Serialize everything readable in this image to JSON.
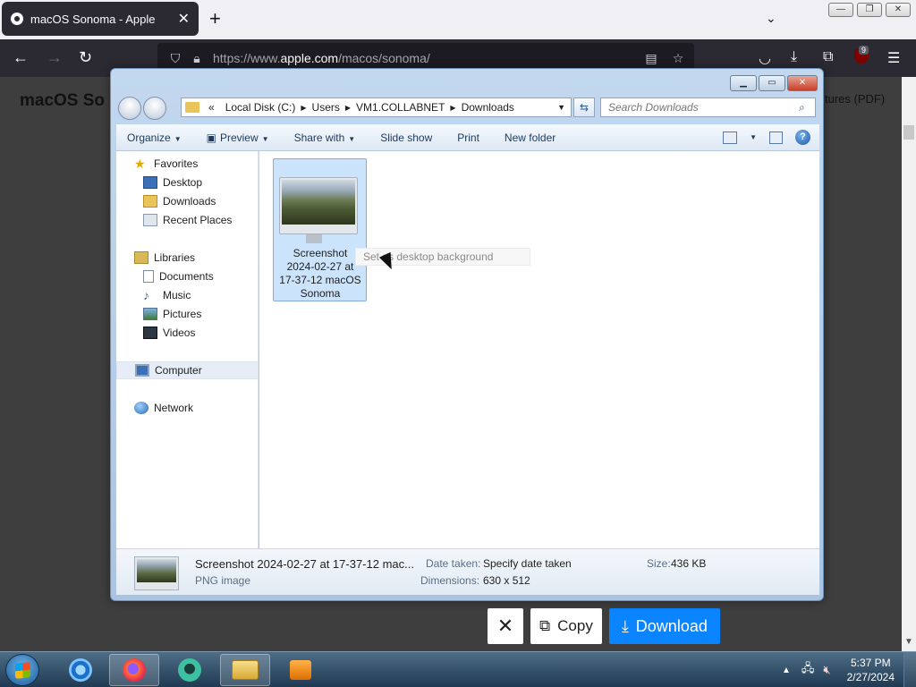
{
  "browser": {
    "tab_title": "macOS Sonoma - Apple",
    "tab_close": "✕",
    "new_tab": "+",
    "list_tabs": "⌄",
    "url_prefix": "https://www.",
    "url_domain": "apple.com",
    "url_path": "/macos/sonoma/",
    "ublock_badge": "9"
  },
  "page": {
    "title": "macOS So",
    "link": "tures (PDF)",
    "overlay": {
      "close": "✕",
      "copy": "Copy",
      "download": "Download"
    }
  },
  "explorer": {
    "breadcrumbs": [
      "Local Disk (C:)",
      "Users",
      "VM1.COLLABNET",
      "Downloads"
    ],
    "search_placeholder": "Search Downloads",
    "commands": [
      "Organize",
      "Preview",
      "Share with",
      "Slide show",
      "Print",
      "New folder"
    ],
    "nav": {
      "favorites": "Favorites",
      "favorites_items": [
        "Desktop",
        "Downloads",
        "Recent Places"
      ],
      "libraries": "Libraries",
      "libraries_items": [
        "Documents",
        "Music",
        "Pictures",
        "Videos"
      ],
      "computer": "Computer",
      "network": "Network"
    },
    "file": {
      "name_line1": "Screenshot",
      "name_line2": "2024-02-27 at",
      "name_line3": "17-37-12 macOS",
      "name_line4": "Sonoma"
    },
    "tooltip": "Set as desktop background",
    "details": {
      "filename": "Screenshot 2024-02-27 at 17-37-12 mac...",
      "filetype": "PNG image",
      "date_label": "Date taken:",
      "date_value": "Specify date taken",
      "dims_label": "Dimensions:",
      "dims_value": "630 x 512",
      "size_label": "Size:",
      "size_value": "436 KB"
    }
  },
  "taskbar": {
    "time": "5:37 PM",
    "date": "2/27/2024"
  },
  "colors": {
    "firefox_dark": "#2b2a33",
    "download_blue": "#0a84ff",
    "selection": "#cce4fb"
  }
}
